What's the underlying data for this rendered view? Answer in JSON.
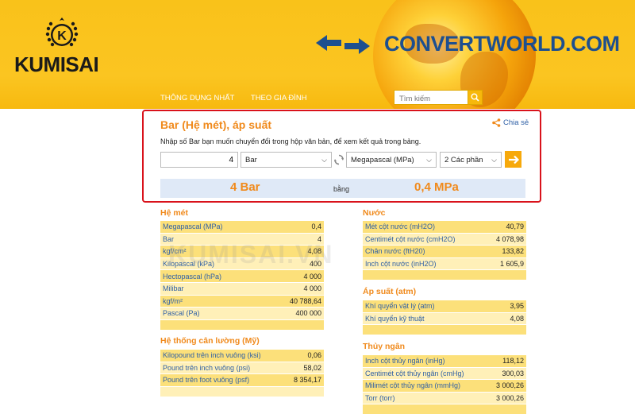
{
  "header": {
    "logo_text": "KUMISAI",
    "logo_letter": "K",
    "brand": "CONVERTWORLD.COM",
    "nav": [
      "THÔNG DỤNG NHẤT",
      "THEO GIA ĐÌNH"
    ],
    "search_placeholder": "Tìm kiếm"
  },
  "converter": {
    "title": "Bar (Hệ mét), áp suất",
    "share": "Chia sẻ",
    "instruction": "Nhập số Bar bạn muốn chuyển đổi trong hộp văn bản, để xem kết quả trong bảng.",
    "input_value": "4",
    "from_unit": "Bar",
    "to_unit": "Megapascal (MPa)",
    "precision": "2 Các phần",
    "result_from": "4 Bar",
    "result_mid": "bằng",
    "result_to": "0,4 MPa"
  },
  "sections": {
    "metric": {
      "title": "Hệ mét",
      "rows": [
        {
          "name": "Megapascal (MPa)",
          "value": "0,4"
        },
        {
          "name": "Bar",
          "value": "4"
        },
        {
          "name": "kgf/cm²",
          "value": "4,08"
        },
        {
          "name": "Kilopascal (kPa)",
          "value": "400"
        },
        {
          "name": "Hectopascal (hPa)",
          "value": "4 000"
        },
        {
          "name": "Milibar",
          "value": "4 000"
        },
        {
          "name": "kgf/m²",
          "value": "40 788,64"
        },
        {
          "name": "Pascal (Pa)",
          "value": "400 000"
        }
      ]
    },
    "imperial": {
      "title": "Hệ thống cân lường (Mỹ)",
      "rows": [
        {
          "name": "Kilopound trên inch vuông (ksi)",
          "value": "0,06"
        },
        {
          "name": "Pound trên inch vuông (psi)",
          "value": "58,02"
        },
        {
          "name": "Pound trên foot vuông (psf)",
          "value": "8 354,17"
        }
      ]
    },
    "water": {
      "title": "Nước",
      "rows": [
        {
          "name": "Mét cột nước (mH2O)",
          "value": "40,79"
        },
        {
          "name": "Centimét cột nước (cmH2O)",
          "value": "4 078,98"
        },
        {
          "name": "Chân nước (ftH20)",
          "value": "133,82"
        },
        {
          "name": "Inch cột nước (inH2O)",
          "value": "1 605,9"
        }
      ]
    },
    "atm": {
      "title": "Áp suất (atm)",
      "rows": [
        {
          "name": "Khí quyển vật lý (atm)",
          "value": "3,95"
        },
        {
          "name": "Khí quyển kỹ thuật",
          "value": "4,08"
        }
      ]
    },
    "mercury": {
      "title": "Thủy ngân",
      "rows": [
        {
          "name": "Inch cột thủy ngân (inHg)",
          "value": "118,12"
        },
        {
          "name": "Centimét cột thủy ngân (cmHg)",
          "value": "300,03"
        },
        {
          "name": "Milimét cột thủy ngân (mmHg)",
          "value": "3 000,26"
        },
        {
          "name": "Torr (torr)",
          "value": "3 000,26"
        }
      ]
    }
  },
  "watermark": "KUMISAI.VN",
  "colors": {
    "accent": "#f08a1c",
    "header": "#fbc521",
    "highlight_border": "#d9121b",
    "link": "#2e5fa5"
  }
}
